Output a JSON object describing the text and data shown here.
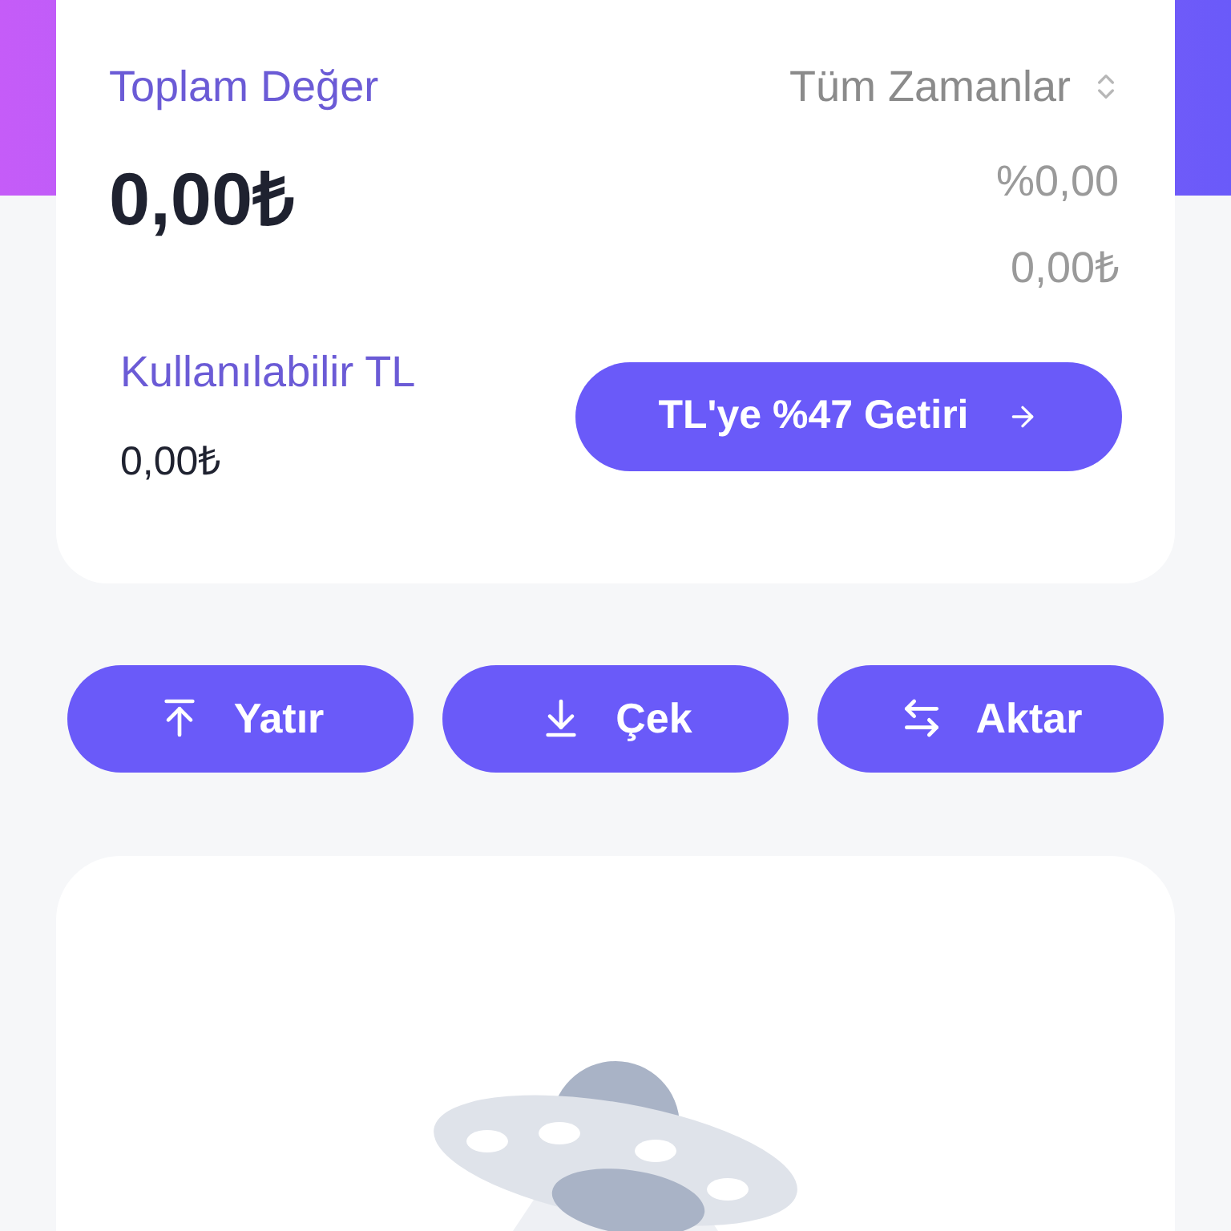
{
  "summary": {
    "title": "Toplam Değer",
    "period": "Tüm Zamanlar",
    "total": "0,00₺",
    "change_percent": "%0,00",
    "change_amount": "0,00₺"
  },
  "available": {
    "label": "Kullanılabilir TL",
    "amount": "0,00₺"
  },
  "promo_button": {
    "label": "TL'ye %47 Getiri"
  },
  "actions": [
    {
      "kind": "deposit",
      "label": "Yatır"
    },
    {
      "kind": "withdraw",
      "label": "Çek"
    },
    {
      "kind": "transfer",
      "label": "Aktar"
    }
  ]
}
